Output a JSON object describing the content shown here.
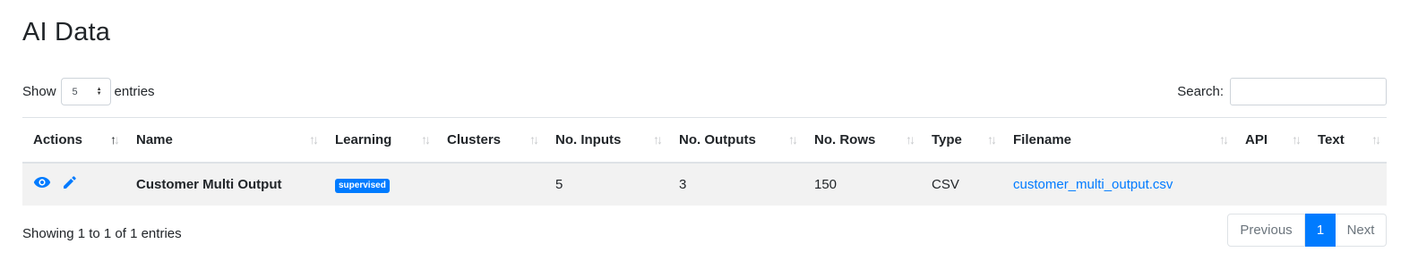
{
  "page": {
    "title": "AI Data"
  },
  "length_menu": {
    "prefix": "Show",
    "value": "5",
    "suffix": "entries"
  },
  "search": {
    "label": "Search:",
    "value": ""
  },
  "table": {
    "columns": [
      "Actions",
      "Name",
      "Learning",
      "Clusters",
      "No. Inputs",
      "No. Outputs",
      "No. Rows",
      "Type",
      "Filename",
      "API",
      "Text"
    ],
    "sorted_column": "Actions",
    "rows": [
      {
        "actions": [
          "eye-icon",
          "pencil-icon"
        ],
        "name": "Customer Multi Output",
        "learning": "supervised",
        "clusters": "",
        "inputs": "5",
        "outputs": "3",
        "rows": "150",
        "type": "CSV",
        "filename": "customer_multi_output.csv",
        "api": "",
        "text": ""
      }
    ]
  },
  "info": "Showing 1 to 1 of 1 entries",
  "pagination": {
    "previous": "Previous",
    "current": "1",
    "next": "Next"
  },
  "colors": {
    "primary": "#007bff",
    "row_bg": "#f2f2f2",
    "border": "#dee2e6"
  }
}
